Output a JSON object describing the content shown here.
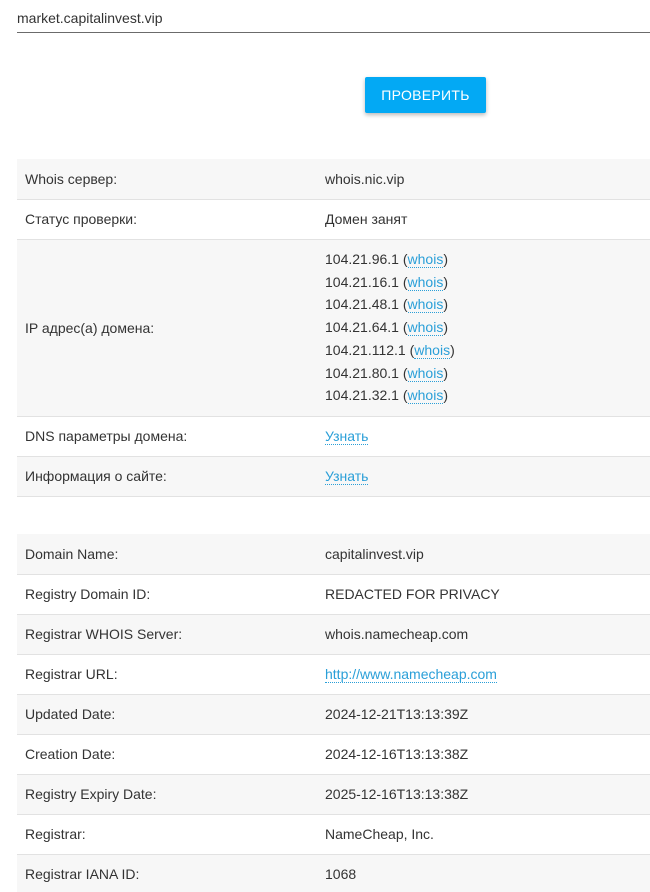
{
  "search": {
    "value": "market.capitalinvest.vip"
  },
  "check_button": {
    "label": "ПРОВЕРИТЬ"
  },
  "summary": {
    "whois_server": {
      "key": "Whois сервер:",
      "value": "whois.nic.vip"
    },
    "status": {
      "key": "Статус проверки:",
      "value": "Домен занят"
    },
    "ips": {
      "key": "IP адрес(а) домена:",
      "whois_label": "whois",
      "items": [
        "104.21.96.1",
        "104.21.16.1",
        "104.21.48.1",
        "104.21.64.1",
        "104.21.112.1",
        "104.21.80.1",
        "104.21.32.1"
      ]
    },
    "dns": {
      "key": "DNS параметры домена:",
      "link": "Узнать"
    },
    "site_info": {
      "key": "Информация о сайте:",
      "link": "Узнать"
    }
  },
  "whois": {
    "rows": [
      {
        "key": "Domain Name:",
        "value": "capitalinvest.vip"
      },
      {
        "key": "Registry Domain ID:",
        "value": "REDACTED FOR PRIVACY"
      },
      {
        "key": "Registrar WHOIS Server:",
        "value": "whois.namecheap.com"
      },
      {
        "key": "Registrar URL:",
        "value": "http://www.namecheap.com"
      },
      {
        "key": "Updated Date:",
        "value": "2024-12-21T13:13:39Z"
      },
      {
        "key": "Creation Date:",
        "value": "2024-12-16T13:13:38Z"
      },
      {
        "key": "Registry Expiry Date:",
        "value": "2025-12-16T13:13:38Z"
      },
      {
        "key": "Registrar:",
        "value": "NameCheap, Inc."
      },
      {
        "key": "Registrar IANA ID:",
        "value": "1068"
      }
    ]
  }
}
